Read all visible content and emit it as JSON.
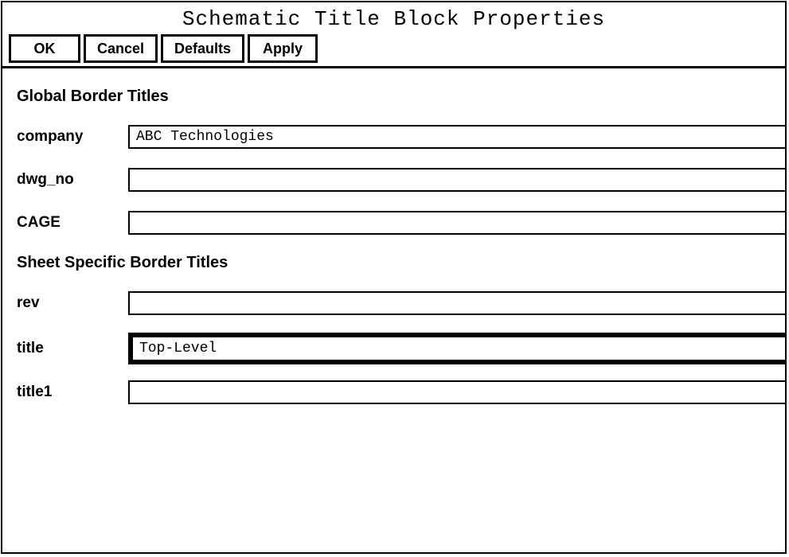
{
  "window": {
    "title": "Schematic Title Block Properties"
  },
  "buttons": {
    "ok": "OK",
    "cancel": "Cancel",
    "defaults": "Defaults",
    "apply": "Apply"
  },
  "sections": {
    "global": "Global Border Titles",
    "sheet": "Sheet Specific Border Titles"
  },
  "fields": {
    "company": {
      "label": "company",
      "value": "ABC Technologies"
    },
    "dwg_no": {
      "label": "dwg_no",
      "value": ""
    },
    "cage": {
      "label": "CAGE",
      "value": ""
    },
    "rev": {
      "label": "rev",
      "value": ""
    },
    "title": {
      "label": "title",
      "value": "Top-Level"
    },
    "title1": {
      "label": "title1",
      "value": ""
    }
  }
}
